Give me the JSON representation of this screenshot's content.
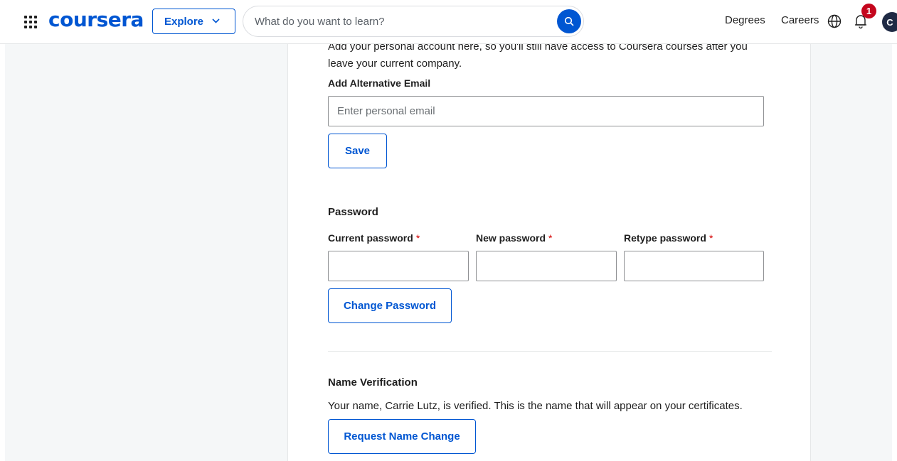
{
  "header": {
    "logo": "coursera",
    "explore_label": "Explore",
    "search_placeholder": "What do you want to learn?",
    "search_value": "",
    "nav": {
      "degrees": "Degrees",
      "careers": "Careers"
    },
    "notification_count": "1",
    "avatar_initial": "C",
    "icons": [
      "apps-grid-icon",
      "chevron-down-icon",
      "search-icon",
      "globe-icon",
      "bell-icon"
    ]
  },
  "alt_email": {
    "description_line1": "Add your personal account here, so you'll still have access to Coursera courses after you",
    "description_line2": "leave your current company.",
    "label": "Add Alternative Email",
    "placeholder": "Enter personal email",
    "value": "",
    "save_label": "Save"
  },
  "password": {
    "title": "Password",
    "current_label": "Current password",
    "new_label": "New password",
    "retype_label": "Retype password",
    "required_mark": "*",
    "change_label": "Change Password"
  },
  "name_verification": {
    "title": "Name Verification",
    "description": "Your name, Carrie Lutz, is verified. This is the name that will appear on your certificates.",
    "request_label": "Request Name Change"
  },
  "colors": {
    "brand": "#0056d2",
    "badge": "#c4061d",
    "required": "#d30001"
  }
}
